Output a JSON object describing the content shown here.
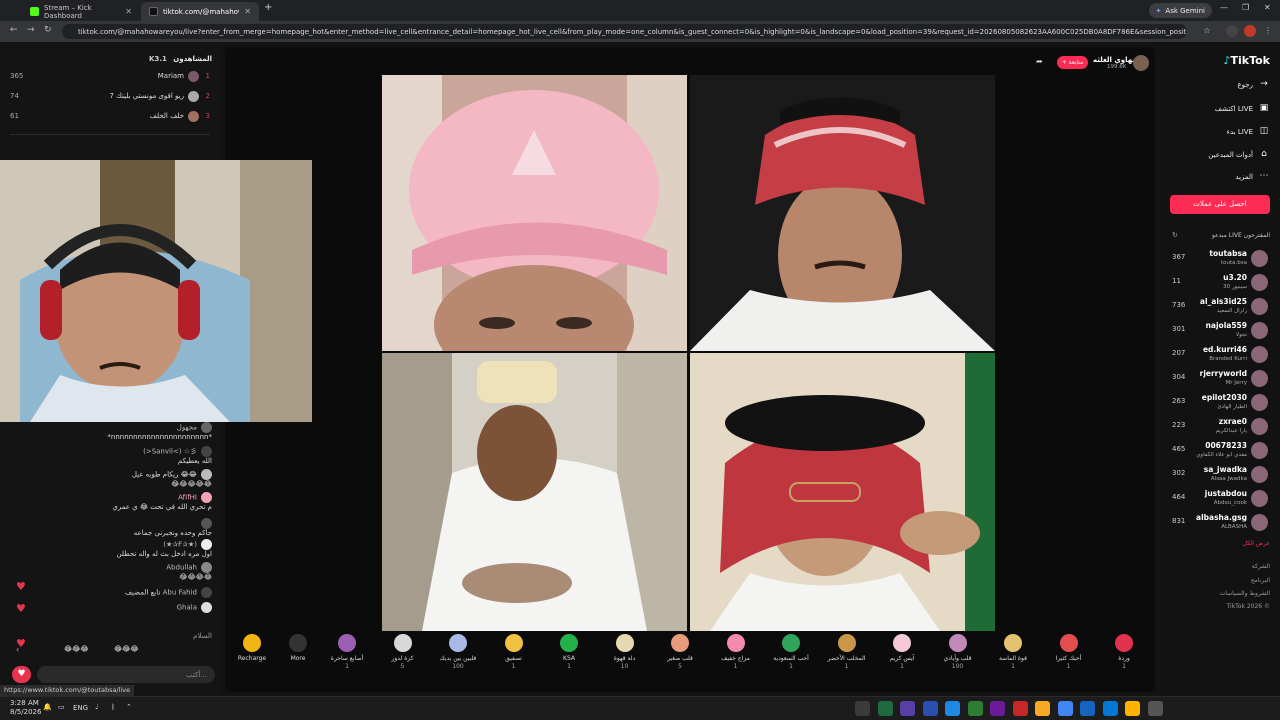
{
  "browser": {
    "tabs": [
      {
        "title": "Stream – Kick Dashboard",
        "active": false
      },
      {
        "title": "tiktok.com/@mahahowar…",
        "active": true
      }
    ],
    "new_tab": "+",
    "gemini": "Ask Gemini",
    "url": "tiktok.com/@mahahowareyou/live?enter_from_merge=homepage_hot&enter_method=live_cell&entrance_detail=homepage_hot_live_cell&from_play_mode=one_column&is_guest_connect=0&is_highlight=0&is_landscape=0&load_position=39&request_id=20260805082623AA600C025DB0A8DF786E&session_position=1"
  },
  "chat": {
    "viewers_title": "المشاهدون",
    "viewers_count": "K3.1",
    "top_viewers": [
      {
        "rank": "1",
        "name": "Mariam",
        "count": "365"
      },
      {
        "rank": "2",
        "name": "ريو اقوى مونستي بليتك 7",
        "count": "74"
      },
      {
        "rank": "3",
        "name": "خلف الخلف",
        "count": "61"
      }
    ],
    "messages": [
      {
        "user": "مجهول",
        "text": ""
      },
      {
        "user": "",
        "text": "*nnnnnnnnnnnnnnnnnnnnnn*"
      },
      {
        "user": "(>Sanvil<) ☆彡",
        "text": "الله يعطيكم"
      },
      {
        "user": "",
        "text": "ريكام طوبه عيل 😂😂"
      },
      {
        "user": "",
        "text": "😂😂😂😂😂"
      },
      {
        "user": "AfIfHI",
        "text": "م تحري الله في تحت 😂 ي عمري"
      },
      {
        "user": "",
        "text": "جاكم وحده ونجبرني جماعه"
      },
      {
        "user": "(★✰F✰★)",
        "text": "اول مره ادخل بث له واله تحطلن"
      },
      {
        "user": "",
        "text": "😂😂😂😂"
      },
      {
        "user": "Abdullah",
        "text": "😂😂😂😂"
      },
      {
        "user": "Abu Fahid",
        "text": "تابع المضيف"
      },
      {
        "user": "Ghala",
        "text": ""
      },
      {
        "user": "",
        "text": "السلام"
      }
    ],
    "quick_emojis": [
      "😂😂😂",
      "😂😂😂"
    ],
    "input_placeholder": "أكتب..."
  },
  "host": {
    "name": "مهاوي الغلثه",
    "likes": "199.8K",
    "follow_label": "+ متابعة"
  },
  "gifts": {
    "recharge_label": "Recharge",
    "more_label": "More",
    "items": [
      {
        "name": "أصابع ساحرة",
        "price": "1",
        "color": "#9a5fb0"
      },
      {
        "name": "كرة لدور",
        "price": "5",
        "color": "#d8d8d8"
      },
      {
        "name": "قلبين بين يديك",
        "price": "100",
        "color": "#a7b9e6"
      },
      {
        "name": "تصفيق",
        "price": "1",
        "color": "#f0c140"
      },
      {
        "name": "KSA",
        "price": "1",
        "color": "#23b24a"
      },
      {
        "name": "دلة قهوة",
        "price": "10",
        "color": "#e6d8b0"
      },
      {
        "name": "قلب صغير",
        "price": "5",
        "color": "#e89a7a"
      },
      {
        "name": "مزاج خفيف",
        "price": "1",
        "color": "#f58ab0"
      },
      {
        "name": "أحب السعودية",
        "price": "1",
        "color": "#2ea55a"
      },
      {
        "name": "المخلب الأخضر",
        "price": "1",
        "color": "#c9964a"
      },
      {
        "name": "آيس كريم",
        "price": "1",
        "color": "#f6c8d8"
      },
      {
        "name": "قلب وأيادي",
        "price": "100",
        "color": "#c08ab8"
      },
      {
        "name": "قوة الماسة",
        "price": "1",
        "color": "#e4c370"
      },
      {
        "name": "أحبك كثيرا",
        "price": "1",
        "color": "#e34d4d"
      },
      {
        "name": "وردة",
        "price": "1",
        "color": "#e2324e"
      }
    ]
  },
  "sidebar": {
    "logo": "TikTok",
    "nav": [
      {
        "label": "رجوع",
        "icon": "arrow"
      },
      {
        "label": "اكتشف LIVE",
        "icon": "tv"
      },
      {
        "label": "بدء LIVE",
        "icon": "camera"
      },
      {
        "label": "أدوات المبدعين",
        "icon": "house"
      },
      {
        "label": "المزيد",
        "icon": "more"
      }
    ],
    "login_label": "احصل على عملات",
    "suggested_title": "مبدعو LIVE المقترحون",
    "suggested": [
      {
        "name": "toutabsa",
        "sub": "touta.bsa",
        "count": "367"
      },
      {
        "name": "u3.20",
        "sub": "سينيور 30",
        "count": "11"
      },
      {
        "name": "al_als3id25",
        "sub": "زلزال السعيد",
        "count": "736"
      },
      {
        "name": "najola559",
        "sub": "نجولا",
        "count": "301"
      },
      {
        "name": "ed.kurri46",
        "sub": "Branded Kurri",
        "count": "207"
      },
      {
        "name": "rjerryworld",
        "sub": "Mr Jerry",
        "count": "304"
      },
      {
        "name": "epilot2030",
        "sub": "الطيار الهادئ",
        "count": "263"
      },
      {
        "name": "zxrae0",
        "sub": "يارا عبدالكريم",
        "count": "223"
      },
      {
        "name": "00678233",
        "sub": "مفدي ابو علاء الكفاوي",
        "count": "465"
      },
      {
        "name": "sa_jwadka",
        "sub": "Alsaa Jwadka",
        "count": "302"
      },
      {
        "name": "justabdou",
        "sub": "Abdou_cook",
        "count": "464"
      },
      {
        "name": "albasha.gsg",
        "sub": "ALBASHA",
        "count": "831"
      }
    ],
    "show_all": "عرض الكل",
    "footer": [
      "الشركة",
      "البرنامج",
      "الشروط والسياسات",
      "TikTok 2026 ©"
    ]
  },
  "status_link": "https://www.tiktok.com/@toutabsa/live",
  "taskbar": {
    "time": "3:28 AM",
    "date": "8/5/2026",
    "lang": "ENG"
  }
}
